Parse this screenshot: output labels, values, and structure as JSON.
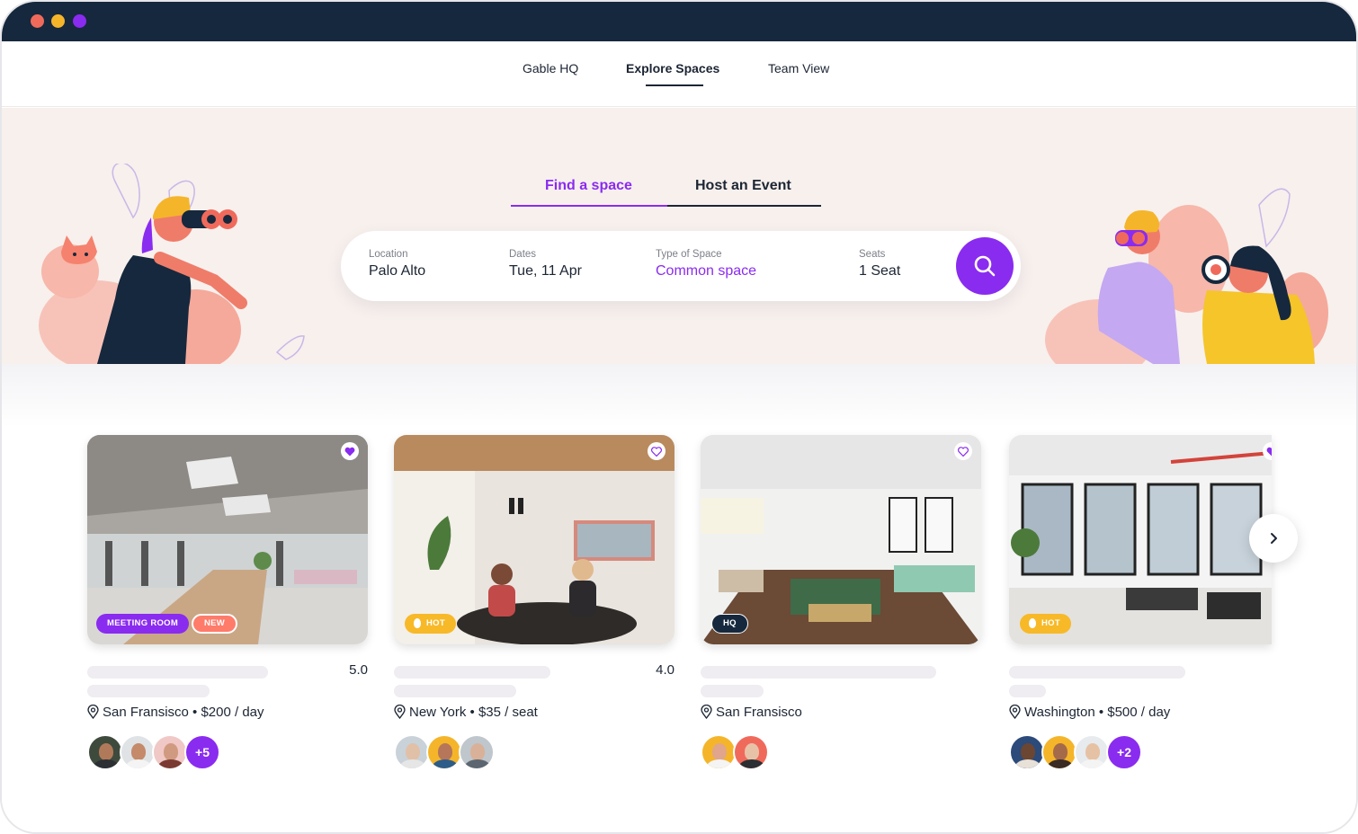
{
  "colors": {
    "accent": "#8a2bf0",
    "navy": "#16283d",
    "coral": "#ff7b6a",
    "hot": "#f7b928",
    "hero_bg": "#f7f0ed"
  },
  "nav": {
    "items": [
      {
        "label": "Gable HQ"
      },
      {
        "label": "Explore Spaces",
        "active": true
      },
      {
        "label": "Team View"
      }
    ]
  },
  "hero": {
    "tabs": [
      {
        "label": "Find a space",
        "active": true
      },
      {
        "label": "Host an Event"
      }
    ],
    "search": {
      "location_label": "Location",
      "location_value": "Palo Alto",
      "dates_label": "Dates",
      "dates_value": "Tue, 11 Apr",
      "type_label": "Type of Space",
      "type_value": "Common space",
      "seats_label": "Seats",
      "seats_value": "1 Seat",
      "button_icon": "search-icon"
    }
  },
  "cards": [
    {
      "badges": [
        "MEETING ROOM",
        "NEW"
      ],
      "favorited": true,
      "rating": "5.0",
      "location": "San Fransisco",
      "price": "• $200 / day",
      "extra_attendees": "+5"
    },
    {
      "badges": [
        "HOT"
      ],
      "favorited": false,
      "rating": "4.0",
      "location": "New York",
      "price": "• $35 / seat",
      "extra_attendees": ""
    },
    {
      "badges": [
        "HQ"
      ],
      "favorited": false,
      "rating": "",
      "location": "San Fransisco",
      "price": "",
      "extra_attendees": ""
    },
    {
      "badges": [
        "HOT"
      ],
      "favorited": true,
      "rating": "",
      "location": "Washington",
      "price": "• $500 / day",
      "extra_attendees": "+2"
    }
  ],
  "icons": {
    "favorite": "heart-icon",
    "location": "map-pin-icon",
    "next": "chevron-right-icon"
  }
}
